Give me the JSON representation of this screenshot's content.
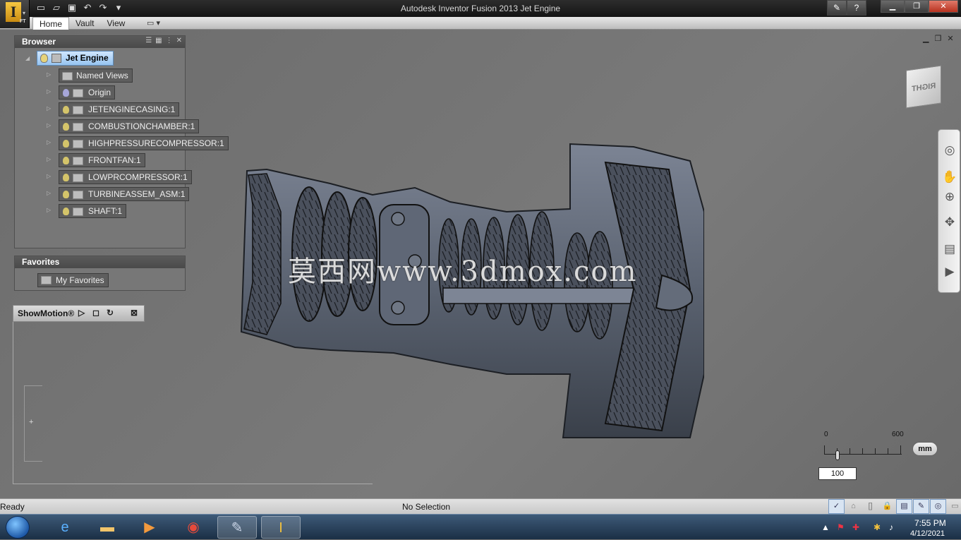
{
  "window": {
    "title": "Autodesk Inventor Fusion 2013   Jet Engine",
    "app_letter": "I",
    "app_sub": "FT"
  },
  "ribbon": {
    "tabs": [
      "Home",
      "Vault",
      "View"
    ]
  },
  "browser": {
    "title": "Browser",
    "root": "Jet Engine",
    "items": [
      "Named Views",
      "Origin",
      "JETENGINECASING:1",
      "COMBUSTIONCHAMBER:1",
      "HIGHPRESSURECOMPRESSOR:1",
      "FRONTFAN:1",
      "LOWPRCOMPRESSOR:1",
      "TURBINEASSEM_ASM:1",
      "SHAFT:1"
    ]
  },
  "favorites": {
    "title": "Favorites",
    "item": "My Favorites"
  },
  "showmotion": {
    "title": "ShowMotion®"
  },
  "viewcube": {
    "face": "RIGHT"
  },
  "scale": {
    "min_label": "0",
    "max_label": "600",
    "unit": "mm",
    "value": "100"
  },
  "watermark": "莫西网www.3dmox.com",
  "status": {
    "left": "Ready",
    "center": "No Selection"
  },
  "taskbar": {
    "time": "7:55 PM",
    "date": "4/12/2021"
  },
  "colors": {
    "viewport": "#6e6e6e",
    "part": "#5a6270",
    "selection": "#96c4f0"
  }
}
